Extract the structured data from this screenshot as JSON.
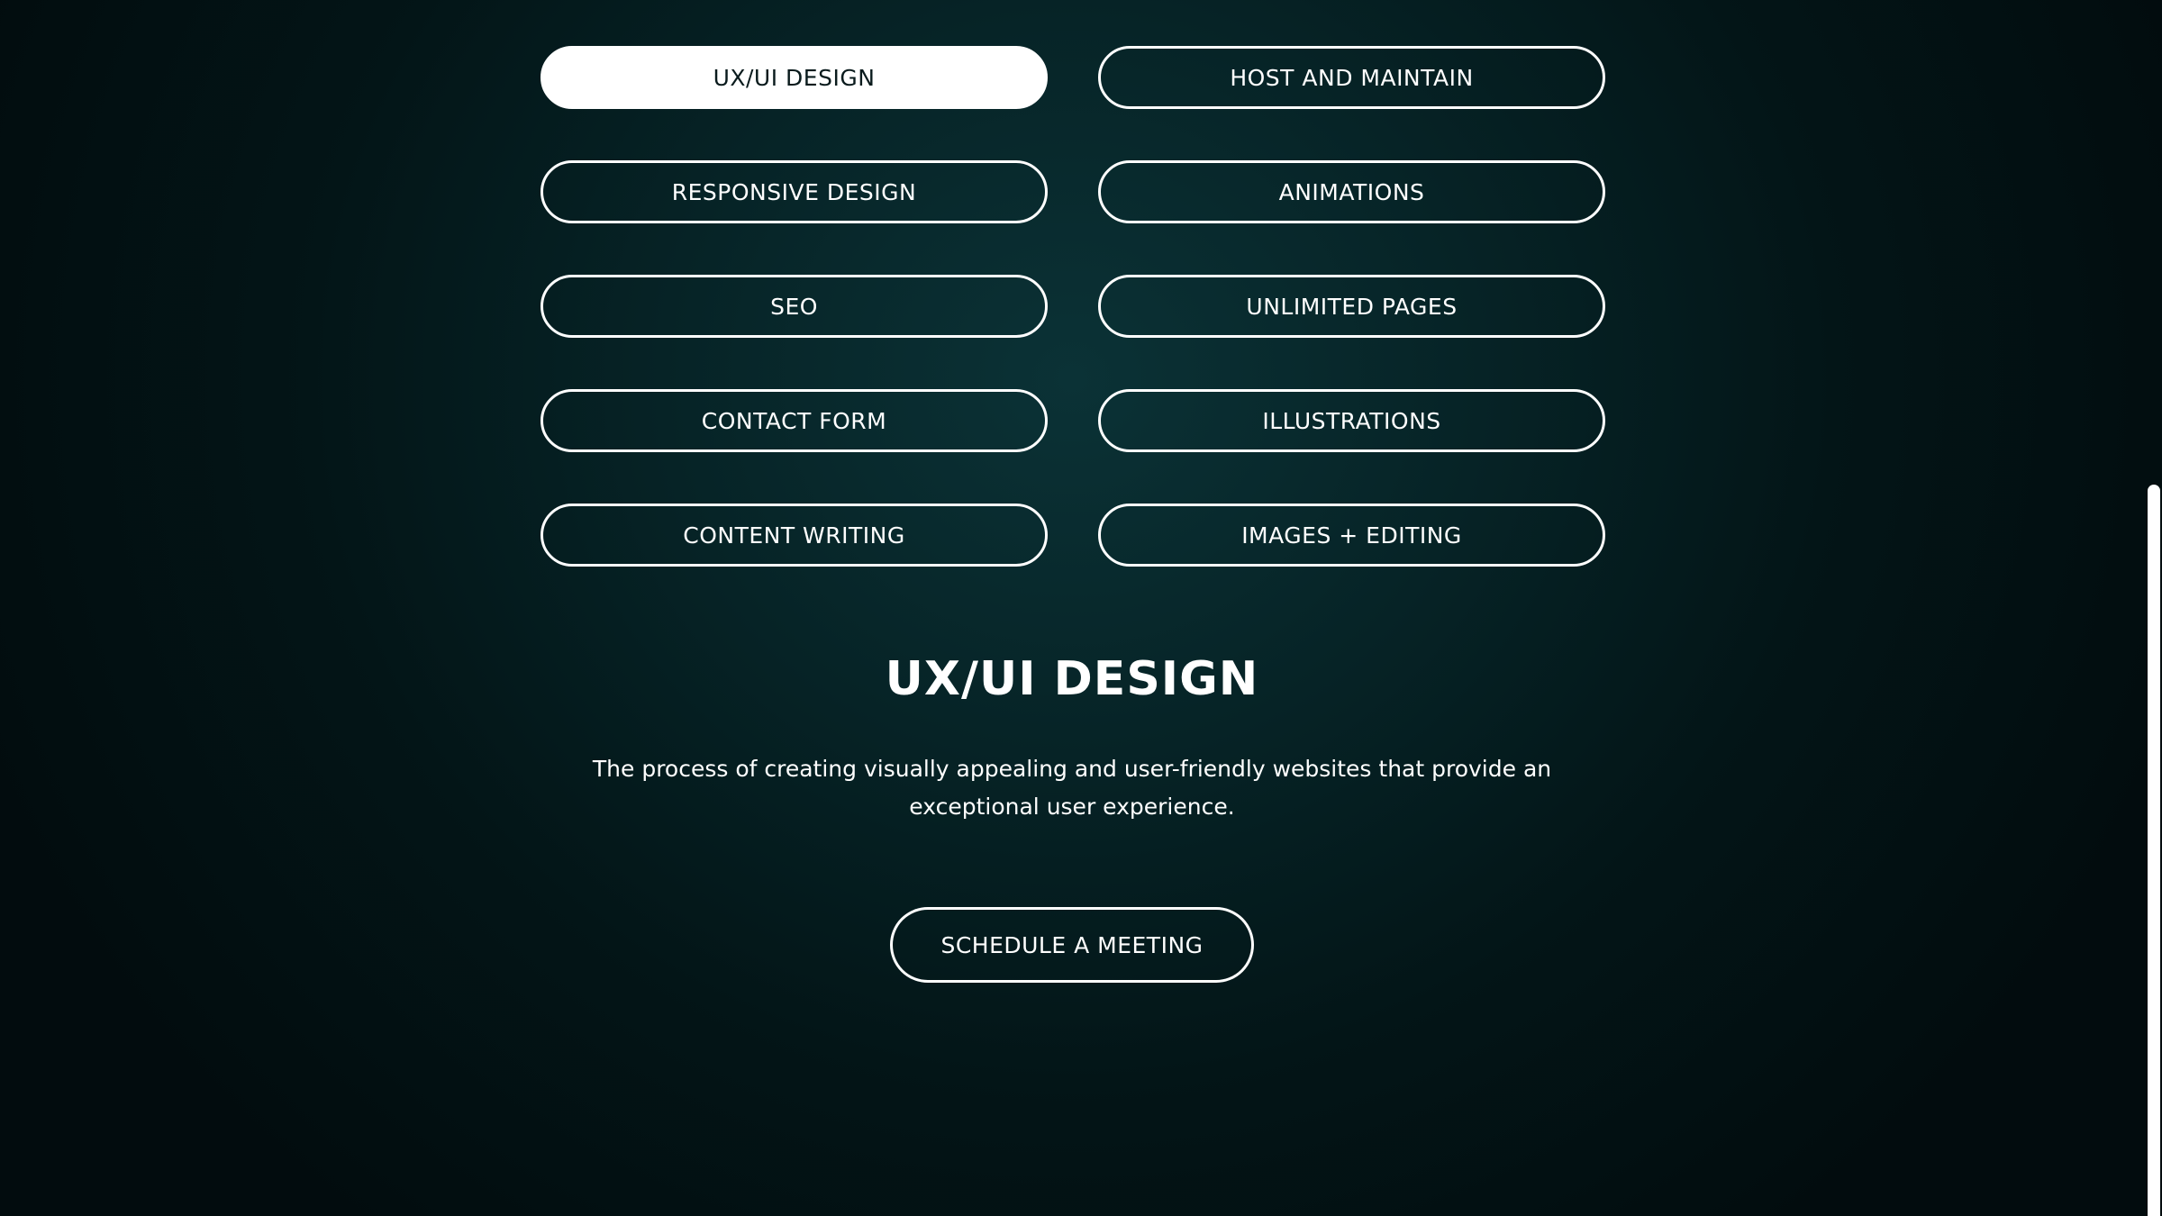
{
  "services": {
    "items": [
      {
        "label": "UX/UI DESIGN",
        "active": true
      },
      {
        "label": "HOST AND MAINTAIN",
        "active": false
      },
      {
        "label": "RESPONSIVE DESIGN",
        "active": false
      },
      {
        "label": "ANIMATIONS",
        "active": false
      },
      {
        "label": "SEO",
        "active": false
      },
      {
        "label": "UNLIMITED PAGES",
        "active": false
      },
      {
        "label": "CONTACT FORM",
        "active": false
      },
      {
        "label": "ILLUSTRATIONS",
        "active": false
      },
      {
        "label": "CONTENT WRITING",
        "active": false
      },
      {
        "label": "IMAGES + EDITING",
        "active": false
      }
    ]
  },
  "detail": {
    "title": "UX/UI DESIGN",
    "description": "The process of creating visually appealing and user-friendly websites that provide an exceptional user experience."
  },
  "cta": {
    "label": "SCHEDULE A MEETING"
  },
  "colors": {
    "background": "#031517",
    "accent": "#ffffff",
    "active_text": "#0a1b1d"
  }
}
